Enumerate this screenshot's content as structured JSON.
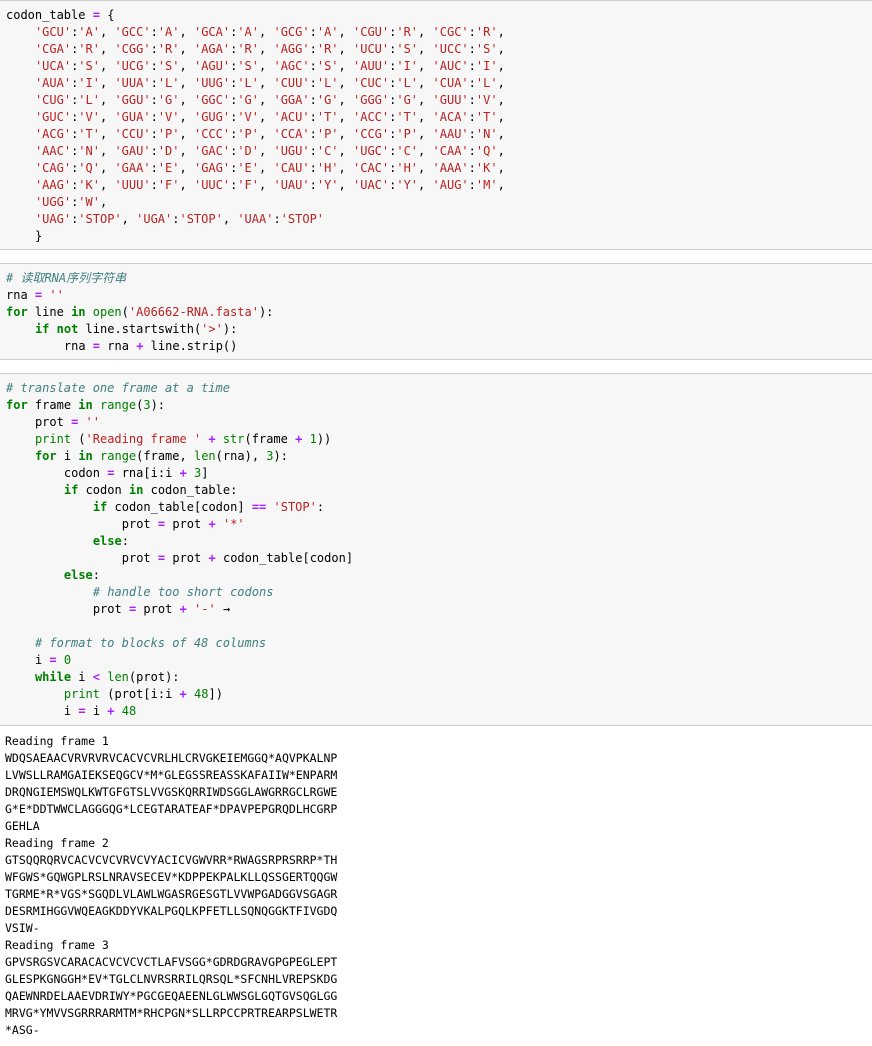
{
  "cells": [
    {
      "name": "codon-table-cell",
      "lines": [
        "codon_table = {",
        "    'GCU':'A', 'GCC':'A', 'GCA':'A', 'GCG':'A', 'CGU':'R', 'CGC':'R',",
        "    'CGA':'R', 'CGG':'R', 'AGA':'R', 'AGG':'R', 'UCU':'S', 'UCC':'S',",
        "    'UCA':'S', 'UCG':'S', 'AGU':'S', 'AGC':'S', 'AUU':'I', 'AUC':'I',",
        "    'AUA':'I', 'UUA':'L', 'UUG':'L', 'CUU':'L', 'CUC':'L', 'CUA':'L',",
        "    'CUG':'L', 'GGU':'G', 'GGC':'G', 'GGA':'G', 'GGG':'G', 'GUU':'V',",
        "    'GUC':'V', 'GUA':'V', 'GUG':'V', 'ACU':'T', 'ACC':'T', 'ACA':'T',",
        "    'ACG':'T', 'CCU':'P', 'CCC':'P', 'CCA':'P', 'CCG':'P', 'AAU':'N',",
        "    'AAC':'N', 'GAU':'D', 'GAC':'D', 'UGU':'C', 'UGC':'C', 'CAA':'Q',",
        "    'CAG':'Q', 'GAA':'E', 'GAG':'E', 'CAU':'H', 'CAC':'H', 'AAA':'K',",
        "    'AAG':'K', 'UUU':'F', 'UUC':'F', 'UAU':'Y', 'UAC':'Y', 'AUG':'M',",
        "    'UGG':'W',",
        "    'UAG':'STOP', 'UGA':'STOP', 'UAA':'STOP'",
        "    }"
      ]
    },
    {
      "name": "read-rna-cell",
      "lines": [
        "# 读取RNA序列字符串",
        "rna = ''",
        "for line in open('A06662-RNA.fasta'):",
        "    if not line.startswith('>'):",
        "        rna = rna + line.strip()"
      ]
    },
    {
      "name": "translate-cell",
      "lines": [
        "# translate one frame at a time",
        "for frame in range(3):",
        "    prot = ''",
        "    print ('Reading frame ' + str(frame + 1))",
        "    for i in range(frame, len(rna), 3):",
        "        codon = rna[i:i + 3]",
        "        if codon in codon_table:",
        "            if codon_table[codon] == 'STOP':",
        "                prot = prot + '*'",
        "            else:",
        "                prot = prot + codon_table[codon]",
        "        else:",
        "            # handle too short codons",
        "            prot = prot + '-' →",
        "",
        "    # format to blocks of 48 columns",
        "    i = 0",
        "    while i < len(prot):",
        "        print (prot[i:i + 48])",
        "        i = i + 48"
      ]
    }
  ],
  "output": [
    "Reading frame 1",
    "WDQSAEAACVRVRVRVCACVCVRLHLCRVGKEIEMGGQ*AQVPKALNP",
    "LVWSLLRAMGAIEKSEQGCV*M*GLEGSSREASSKAFAIIW*ENPARM",
    "DRQNGIEMSWQLKWTGFGTSLVVGSKQRRIWDSGGLAWGRRGCLRGWE",
    "G*E*DDTWWCLAGGGQG*LCEGTARATEAF*DPAVPEPGRQDLHCGRP",
    "GEHLA",
    "Reading frame 2",
    "GTSQQRQRVCACVCVCVRVCVYACICVGWVRR*RWAGSRPRSRRP*TH",
    "WFGWS*GQWGPLRSLNRAVSECEV*KDPPEKPALKLLQSSGERTQQGW",
    "TGRME*R*VGS*SGQDLVLAWLWGASRGESGTLVVWPGADGGVSGAGR",
    "DESRMIHGGVWQEAGKDDYVKALPGQLKPFETLLSQNQGGKTFIVGDQ",
    "VSIW-",
    "Reading frame 3",
    "GPVSRGSVCARACACVCVCVCTLAFVSGG*GDRDGRAVGPGPEGLEPT",
    "GLESPKGNGGH*EV*TGLCLNVRSRRILQRSQL*SFCNHLVREPSKDG",
    "QAEWNRDELAAEVDRIWY*PGCGEQAEENLGLWWSGLGQTGVSQGLGG",
    "MRVG*YMVVSGRRRARMTM*RHCPGN*SLLRPCCPRTREARPSLWETR",
    "*ASG-"
  ]
}
